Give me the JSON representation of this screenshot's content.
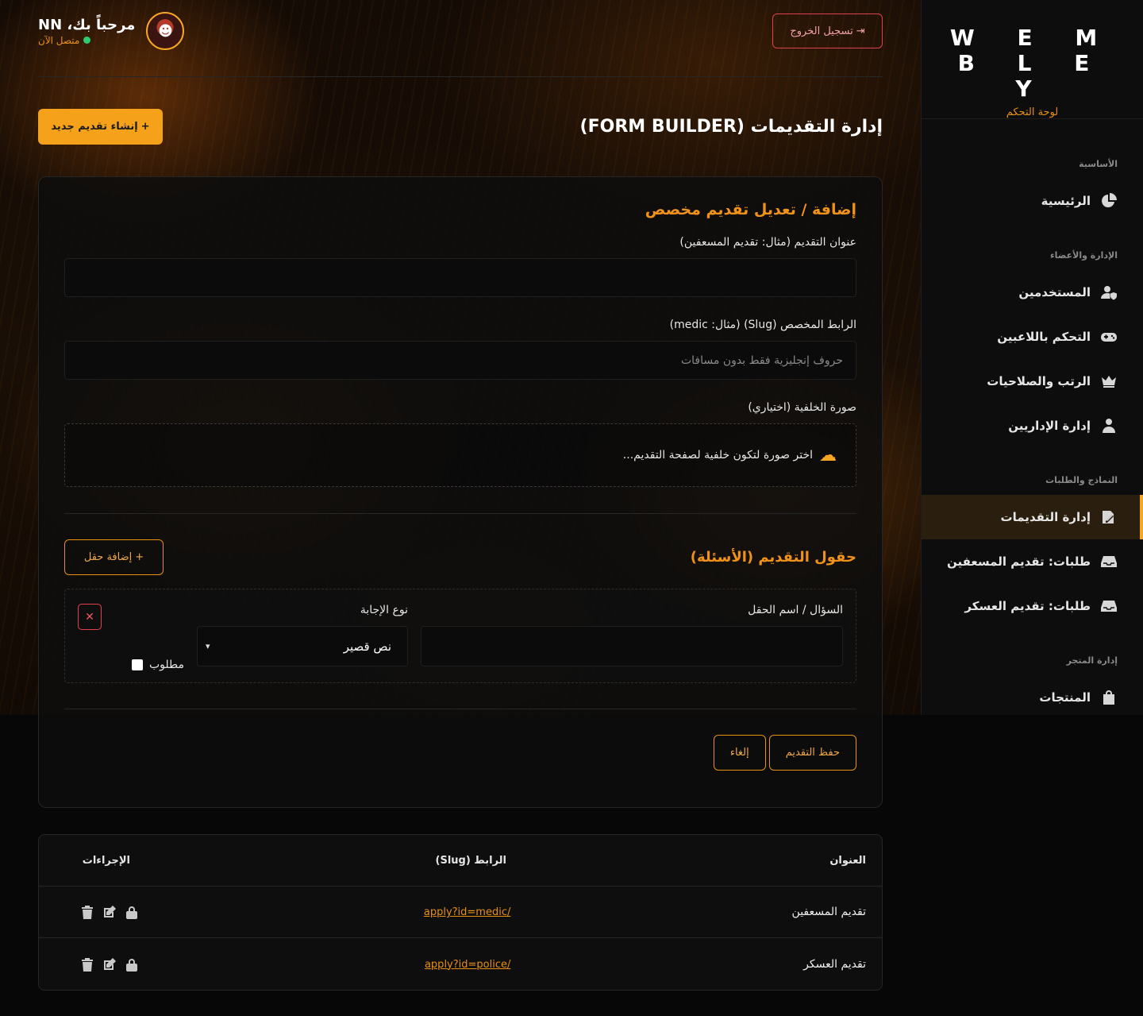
{
  "sidebar": {
    "brand": "W E M B L E Y",
    "subtitle": "لوحة التحكم",
    "groups": [
      {
        "label": "الأساسية",
        "items": [
          {
            "label": "الرئيسية",
            "icon": "pie-chart-icon"
          }
        ]
      },
      {
        "label": "الإدارة والأعضاء",
        "items": [
          {
            "label": "المستخدمين",
            "icon": "user-shield-icon"
          },
          {
            "label": "التحكم باللاعبين",
            "icon": "gamepad-icon"
          },
          {
            "label": "الرتب والصلاحيات",
            "icon": "crown-icon"
          },
          {
            "label": "إدارة الإداريين",
            "icon": "user-tie-icon"
          }
        ]
      },
      {
        "label": "النماذج والطلبات",
        "items": [
          {
            "label": "إدارة التقديمات",
            "icon": "file-signature-icon",
            "active": true
          },
          {
            "label": "طلبات: تقديم المسعفين",
            "icon": "inbox-icon"
          },
          {
            "label": "طلبات: تقديم العسكر",
            "icon": "inbox-icon"
          }
        ]
      },
      {
        "label": "إدارة المتجر",
        "items": [
          {
            "label": "المنتجات",
            "icon": "shopping-bag-icon"
          }
        ]
      }
    ]
  },
  "header": {
    "user_name": "مرحباً بك، NN",
    "status": "متصل الآن",
    "logout_label": "تسجيل الخروج"
  },
  "page": {
    "title": "إدارة التقديمات (FORM BUILDER)",
    "create_label": "إنشاء تقديم جديد"
  },
  "form": {
    "card_title": "إضافة / تعديل تقديم مخصص",
    "title_label": "عنوان التقديم (مثال: تقديم المسعفين)",
    "title_value": "",
    "slug_label": "الرابط المخصص (Slug) (مثال: medic)",
    "slug_placeholder": "حروف إنجليزية فقط بدون مسافات",
    "bg_label": "صورة الخلفية (اختياري)",
    "upload_text": "اختر صورة لتكون خلفية لصفحة التقديم...",
    "fields_title": "حقول التقديم (الأسئلة)",
    "add_field_label": "إضافة حقل",
    "field": {
      "question_label": "السؤال / اسم الحقل",
      "question_value": "",
      "type_label": "نوع الإجابة",
      "type_value": "نص قصير",
      "required_label": "مطلوب"
    },
    "save_label": "حفظ التقديم",
    "cancel_label": "إلغاء"
  },
  "table": {
    "headers": {
      "title": "العنوان",
      "slug": "الرابط (Slug)",
      "actions": "الإجراءات"
    },
    "rows": [
      {
        "title": "تقديم المسعفين",
        "slug": "/apply?id=medic"
      },
      {
        "title": "تقديم العسكر",
        "slug": "/apply?id=police"
      }
    ]
  },
  "colors": {
    "accent": "#f5a21a",
    "danger": "#e0424b",
    "online": "#2ecc71"
  }
}
